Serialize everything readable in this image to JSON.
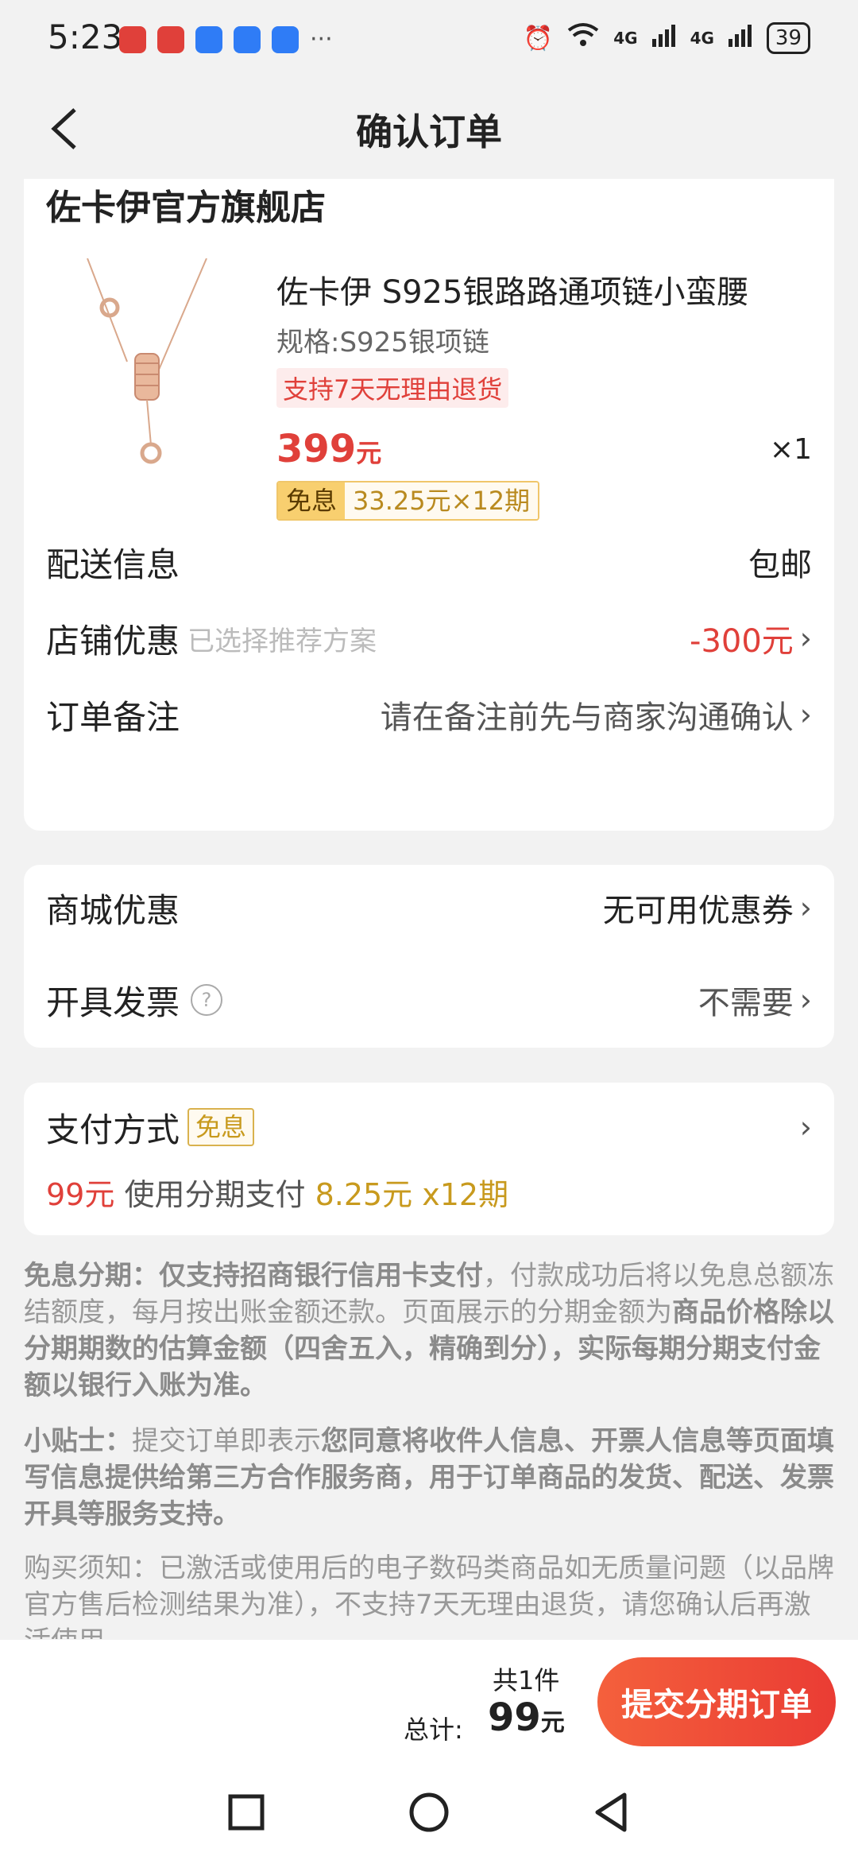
{
  "status": {
    "time": "5:23",
    "battery": "39",
    "signal_labels": [
      "4G",
      "4G"
    ]
  },
  "nav": {
    "title": "确认订单"
  },
  "shop": {
    "name": "佐卡伊官方旗舰店"
  },
  "product": {
    "title": "佐卡伊 S925银路路通项链小蛮腰",
    "spec": "规格:S925银项链",
    "return_badge": "支持7天无理由退货",
    "price": "399",
    "price_unit": "元",
    "qty": "×1",
    "installment_badge": "免息",
    "installment_text": "33.25元×12期"
  },
  "rows": {
    "delivery_label": "配送信息",
    "delivery_value": "包邮",
    "shop_discount_label": "店铺优惠",
    "shop_discount_hint": "已选择推荐方案",
    "shop_discount_value": "-300元",
    "remark_label": "订单备注",
    "remark_value": "请在备注前先与商家沟通确认",
    "mall_discount_label": "商城优惠",
    "mall_discount_value": "无可用优惠券",
    "invoice_label": "开具发票",
    "invoice_value": "不需要"
  },
  "payment": {
    "label": "支付方式",
    "badge": "免息",
    "amount": "99元",
    "desc": "使用分期支付",
    "installment": "8.25元 x12期"
  },
  "notes": {
    "n1_title": "免息分期：",
    "n1_bold": "仅支持招商银行信用卡支付",
    "n1_text": "，付款成功后将以免息总额冻结额度，每月按出账金额还款。页面展示的分期金额为",
    "n1_bold2": "商品价格除以分期期数的估算金额（四舍五入，精确到分），实际每期分期支付金额以银行入账为准。",
    "n2_title": "小贴士：",
    "n2_text": "提交订单即表示",
    "n2_bold": "您同意将收件人信息、开票人信息等页面填写信息提供给第三方合作服务商，用于订单商品的发货、配送、发票开具等服务支持。",
    "n3_text": "购买须知：已激活或使用后的电子数码类商品如无质量问题（以品牌官方售后检测结果为准），不支持7天无理由退货，请您确认后再激活使用。"
  },
  "bottom": {
    "count": "共1件",
    "total_label": "总计:",
    "total_value": "99",
    "total_unit": "元",
    "submit": "提交分期订单"
  },
  "colors": {
    "accent_red": "#e0403a",
    "gold": "#c89a1e",
    "submit_start": "#f4603c",
    "submit_end": "#ea3c34"
  }
}
